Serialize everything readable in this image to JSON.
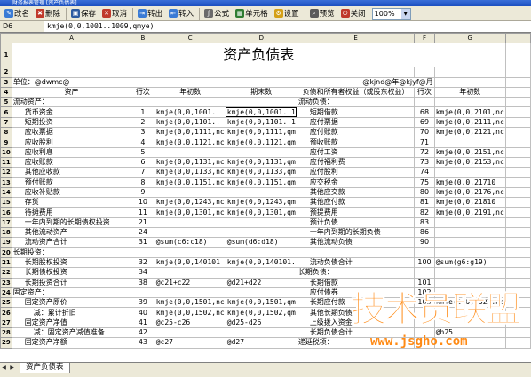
{
  "window": {
    "title": "财务报表管理 [资产负债表]"
  },
  "toolbar": {
    "buttons": [
      {
        "label": "改名",
        "icon": "rename-icon",
        "color": "#3a7bd5"
      },
      {
        "label": "删除",
        "icon": "delete-icon",
        "color": "#c0392b"
      },
      {
        "label": "保存",
        "icon": "save-icon",
        "color": "#2c5aa0"
      },
      {
        "label": "取消",
        "icon": "cancel-icon",
        "color": "#c0392b"
      },
      {
        "label": "转出",
        "icon": "export-icon",
        "color": "#3a7bd5"
      },
      {
        "label": "转入",
        "icon": "import-icon",
        "color": "#3a7bd5"
      },
      {
        "label": "公式",
        "icon": "formula-icon",
        "color": "#6b6b6b"
      },
      {
        "label": "单元格",
        "icon": "cell-icon",
        "color": "#2f7d32"
      },
      {
        "label": "设置",
        "icon": "settings-icon",
        "color": "#d4a017"
      },
      {
        "label": "预览",
        "icon": "preview-icon",
        "color": "#5a5a5a"
      },
      {
        "label": "关闭",
        "icon": "close-icon",
        "color": "#c0392b"
      }
    ],
    "zoom": "100%"
  },
  "formula_bar": {
    "cell_ref": "D6",
    "formula": "kmje(0,0,1001..1009,qmye)"
  },
  "columns": [
    "A",
    "B",
    "C",
    "D",
    "E",
    "F",
    "G"
  ],
  "sheet": {
    "title": "资产负债表",
    "unit_label": "单位：@dwmc@",
    "date_label": "@kjnd@年@kjyf@月",
    "headers": [
      "资产",
      "行次",
      "年初数",
      "期末数",
      "负债和所有者权益（或股东权益）",
      "行次",
      "年初数"
    ],
    "rows": [
      {
        "n": "5",
        "c": [
          "流动资产：",
          "",
          "",
          "",
          "流动负债：",
          "",
          ""
        ]
      },
      {
        "n": "6",
        "c": [
          "货币资金",
          "1",
          "kmje(0,0,1001..",
          "kmje(0,0,1001..1",
          "短期借款",
          "68",
          "kmje(0,0,2101,nc"
        ]
      },
      {
        "n": "7",
        "c": [
          "短期投资",
          "2",
          "kmje(0,0,1101..",
          "kmje(0,0,1101..1",
          "应付票据",
          "69",
          "kmje(0,0,2111,nc"
        ]
      },
      {
        "n": "8",
        "c": [
          "应收票据",
          "3",
          "kmje(0,0,1111,nc",
          "kmje(0,0,1111,qm",
          "应付账款",
          "70",
          "kmje(0,0,2121,nc"
        ]
      },
      {
        "n": "9",
        "c": [
          "应收股利",
          "4",
          "kmje(0,0,1121,nc",
          "kmje(0,0,1121,qm",
          "预收账款",
          "71",
          ""
        ]
      },
      {
        "n": "10",
        "c": [
          "应收利息",
          "5",
          "",
          "",
          "应付工资",
          "72",
          "kmje(0,0,2151,nc"
        ]
      },
      {
        "n": "11",
        "c": [
          "应收账款",
          "6",
          "kmje(0,0,1131,nc",
          "kmje(0,0,1131,qm",
          "应付福利费",
          "73",
          "kmje(0,0,2153,nc"
        ]
      },
      {
        "n": "12",
        "c": [
          "其他应收款",
          "7",
          "kmje(0,0,1133,nc",
          "kmje(0,0,1133,qm",
          "应付股利",
          "74",
          ""
        ]
      },
      {
        "n": "13",
        "c": [
          "预付账款",
          "8",
          "kmje(0,0,1151,nc",
          "kmje(0,0,1151,qm",
          "应交税金",
          "75",
          "kmje(0,0,21710"
        ]
      },
      {
        "n": "14",
        "c": [
          "应收补贴款",
          "9",
          "",
          "",
          "其他应交款",
          "80",
          "kmje(0,0,2176,nc"
        ]
      },
      {
        "n": "15",
        "c": [
          "存货",
          "10",
          "kmje(0,0,1243,nc",
          "kmje(0,0,1243,qm",
          "其他应付款",
          "81",
          "kmje(0,0,21810"
        ]
      },
      {
        "n": "16",
        "c": [
          "待摊费用",
          "11",
          "kmje(0,0,1301,nc",
          "kmje(0,0,1301,qm",
          "预提费用",
          "82",
          "kmje(0,0,2191,nc"
        ]
      },
      {
        "n": "17",
        "c": [
          "一年内到期的长期债权投资",
          "21",
          "",
          "",
          "预计负债",
          "83",
          ""
        ]
      },
      {
        "n": "18",
        "c": [
          "其他流动资产",
          "24",
          "",
          "",
          "一年内到期的长期负债",
          "86",
          ""
        ]
      },
      {
        "n": "19",
        "c": [
          "流动资产合计",
          "31",
          "@sum(c6:c18)",
          "@sum(d6:d18)",
          "其他流动负债",
          "90",
          ""
        ]
      },
      {
        "n": "20",
        "c": [
          "长期投资：",
          "",
          "",
          "",
          "",
          "",
          ""
        ]
      },
      {
        "n": "21",
        "c": [
          "长期股权投资",
          "32",
          "kmje(0,0,140101",
          "kmje(0,0,140101.",
          "流动负债合计",
          "100",
          "@sum(g6:g19)"
        ]
      },
      {
        "n": "22",
        "c": [
          "长期债权投资",
          "34",
          "",
          "",
          "长期负债：",
          "",
          ""
        ]
      },
      {
        "n": "23",
        "c": [
          "长期投资合计",
          "38",
          "@c21+c22",
          "@d21+d22",
          "长期借款",
          "101",
          ""
        ]
      },
      {
        "n": "24",
        "c": [
          "固定资产：",
          "",
          "",
          "",
          "应付债券",
          "102",
          ""
        ]
      },
      {
        "n": "25",
        "c": [
          "固定资产原价",
          "39",
          "kmje(0,0,1501,nc",
          "kmje(0,0,1501,qm",
          "长期应付款",
          "103",
          "kmje(0,0,2321,nc"
        ]
      },
      {
        "n": "26",
        "c": [
          "减：累计折旧",
          "40",
          "kmje(0,0,1502,nc",
          "kmje(0,0,1502,qm",
          "其他长期负债",
          "",
          ""
        ]
      },
      {
        "n": "27",
        "c": [
          "固定资产净值",
          "41",
          "@c25-c26",
          "@d25-d26",
          "上级拨入资金",
          "",
          ""
        ]
      },
      {
        "n": "28",
        "c": [
          "减：固定资产减值准备",
          "42",
          "",
          "",
          "长期负债合计",
          "",
          "@h25"
        ]
      },
      {
        "n": "29",
        "c": [
          "固定资产净额",
          "43",
          "@c27",
          "@d27",
          "递延税项：",
          "",
          ""
        ]
      }
    ]
  },
  "tabs": [
    "资产负债表"
  ],
  "watermark": {
    "main": "技术员联盟",
    "url": "www.jsgho.com"
  }
}
